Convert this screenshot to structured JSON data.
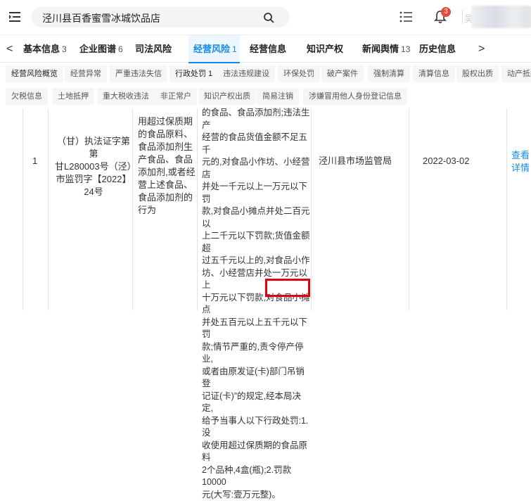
{
  "header": {
    "search_value": "泾川县百香蜜雪冰城饮品店",
    "badge_count": "3",
    "user_glyph": "吴"
  },
  "tabs": [
    {
      "label": "基本信息",
      "count": "3"
    },
    {
      "label": "企业图谱",
      "count": "6"
    },
    {
      "label": "司法风险",
      "count": ""
    },
    {
      "label": "经营风险",
      "count": "1"
    },
    {
      "label": "经营信息",
      "count": ""
    },
    {
      "label": "知识产权",
      "count": ""
    },
    {
      "label": "新闻舆情",
      "count": "13"
    },
    {
      "label": "历史信息",
      "count": ""
    }
  ],
  "tab_nav": {
    "prev": "<",
    "next": ">"
  },
  "chips_row1": [
    "经营风险概览",
    "经营异常",
    "严重违法失信",
    "行政处罚 1",
    "违法违规建设",
    "环保处罚",
    "破产案件",
    "强制清算",
    "清算信息",
    "股权出质",
    "动产抵押"
  ],
  "chips_row2": [
    "欠税信息",
    "土地抵押",
    "重大税收违法",
    "非正常户",
    "知识产权出质",
    "简易注销",
    "涉嫌冒用他人身份登记信息"
  ],
  "row": {
    "index": "1",
    "doc_no": [
      "（甘）执法证字第第",
      "甘L280003号（泾）",
      "市监罚字【2022】",
      "24号"
    ],
    "violation": [
      "用超过保质期",
      "的食品原料、",
      "食品添加剂生",
      "产食品、食品",
      "添加剂,或者经",
      "营上述食品、",
      "食品添加剂的",
      "行为"
    ],
    "basis": [
      "的食品、食品添加剂;违法生产",
      "经营的食品货值金额不足五千",
      "元的,对食品小作坊、小经营店",
      "并处一千元以上一万元以下罚",
      "款,对食品小摊点并处二百元以",
      "上二千元以下罚款;货值金额超",
      "过五千元以上的,对食品小作",
      "坊、小经营店并处一万元以上",
      "十万元以下罚款,对食品小摊点",
      "并处五百元以上五千元以下罚",
      "款;情节严重的,责令停产停业,",
      "或者由原发证(卡)部门吊销登",
      "记证(卡)”的规定,经本局决定,",
      "给予当事人以下行政处罚:1.没",
      "收使用超过保质期的食品原料",
      "2个品种,4盒(瓶);2.罚款10000",
      "元(大写:壹万元整)。"
    ],
    "authority": "泾川县市场监管局",
    "date": "2022-03-02",
    "action": [
      "查看",
      "详情"
    ]
  }
}
